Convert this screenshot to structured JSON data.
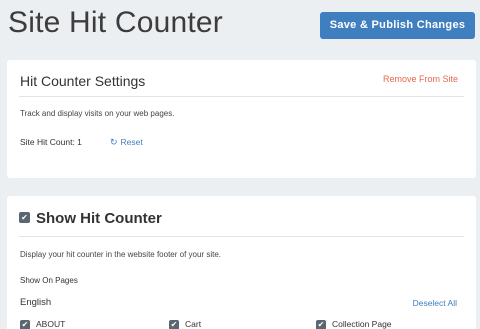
{
  "header": {
    "title": "Site Hit Counter",
    "publish_label": "Save & Publish Changes"
  },
  "settings_card": {
    "title": "Hit Counter Settings",
    "remove_label": "Remove From Site",
    "description": "Track and display visits on your web pages.",
    "hit_count_label": "Site Hit Count: 1",
    "reset_label": "Reset"
  },
  "show_card": {
    "title": "Show Hit Counter",
    "checked": true,
    "description": "Display your hit counter in the website footer of your site.",
    "show_on_pages_label": "Show On Pages",
    "language": "English",
    "deselect_label": "Deselect All",
    "pages": [
      {
        "label": "ABOUT",
        "checked": true
      },
      {
        "label": "Cart",
        "checked": true
      },
      {
        "label": "Collection Page",
        "checked": true
      }
    ]
  },
  "icons": {
    "reset": "refresh-icon",
    "checkbox": "checkmark-icon"
  },
  "colors": {
    "accent": "#3f7fbf",
    "danger": "#e8674d",
    "checkbox": "#5b6770",
    "background": "#eceff1"
  }
}
